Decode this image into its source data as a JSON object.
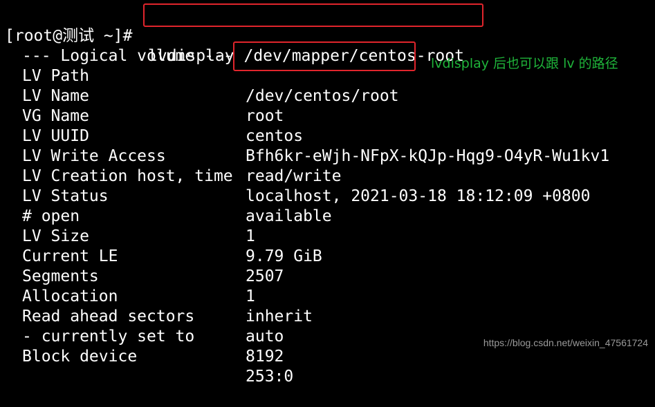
{
  "terminal": {
    "prompt": "[root@测试 ~]#",
    "command": "lvdisplay /dev/mapper/centos-root",
    "section_header": "--- Logical volume ---",
    "rows": [
      {
        "key": "LV Path",
        "value": "/dev/centos/root"
      },
      {
        "key": "LV Name",
        "value": "root"
      },
      {
        "key": "VG Name",
        "value": "centos"
      },
      {
        "key": "LV UUID",
        "value": "Bfh6kr-eWjh-NFpX-kQJp-Hqg9-O4yR-Wu1kv1"
      },
      {
        "key": "LV Write Access",
        "value": "read/write"
      },
      {
        "key": "LV Creation host, time",
        "value": "localhost, 2021-03-18 18:12:09 +0800"
      },
      {
        "key": "LV Status",
        "value": "available"
      },
      {
        "key": "# open",
        "value": "1"
      },
      {
        "key": "LV Size",
        "value": "9.79 GiB"
      },
      {
        "key": "Current LE",
        "value": "2507"
      },
      {
        "key": "Segments",
        "value": "1"
      },
      {
        "key": "Allocation",
        "value": "inherit"
      },
      {
        "key": "Read ahead sectors",
        "value": "auto"
      },
      {
        "key": "- currently set to",
        "value": "8192"
      },
      {
        "key": "Block device",
        "value": "253:0"
      }
    ]
  },
  "annotation": {
    "text": "lvdisplay 后也可以跟 lv 的路径",
    "color": "#1fb43a"
  },
  "highlight_color": "#e1252c",
  "watermark": "https://blog.csdn.net/weixin_47561724"
}
